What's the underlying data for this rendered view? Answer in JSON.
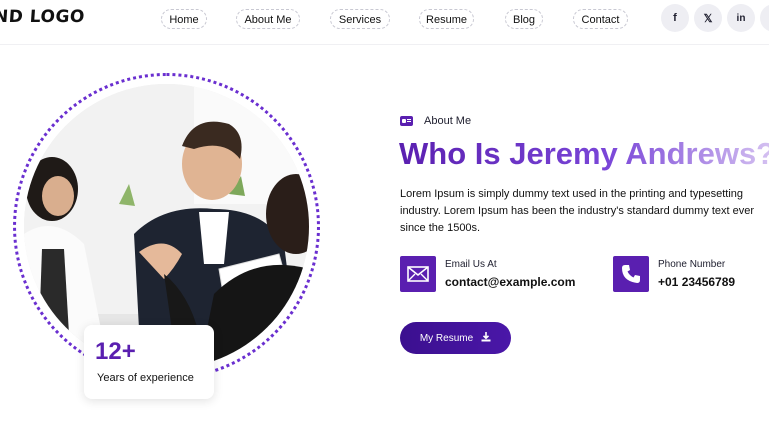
{
  "header": {
    "logo": "ND LOGO",
    "nav": [
      {
        "label": "Home"
      },
      {
        "label": "About Me"
      },
      {
        "label": "Services"
      },
      {
        "label": "Resume"
      },
      {
        "label": "Blog"
      },
      {
        "label": "Contact"
      }
    ],
    "social": [
      {
        "icon": "facebook-icon",
        "glyph": "f"
      },
      {
        "icon": "x-twitter-icon",
        "glyph": "𝕏"
      },
      {
        "icon": "linkedin-icon",
        "glyph": "in"
      }
    ]
  },
  "hero": {
    "experience": {
      "number": "12+",
      "label": "Years of experience"
    },
    "about_tag": "About Me",
    "headline": "Who Is Jeremy Andrews?",
    "description": "Lorem Ipsum is simply dummy text used in the printing and typesetting industry. Lorem Ipsum has been the industry's standard dummy text ever since the 1500s.",
    "email": {
      "label": "Email Us At",
      "value": "contact@example.com"
    },
    "phone": {
      "label": "Phone Number",
      "value": "+01 23456789"
    },
    "resume_button": "My Resume"
  },
  "colors": {
    "accent": "#5a1fb0",
    "accent_dark": "#3b0f8f",
    "social_bg": "#eeeef3"
  }
}
